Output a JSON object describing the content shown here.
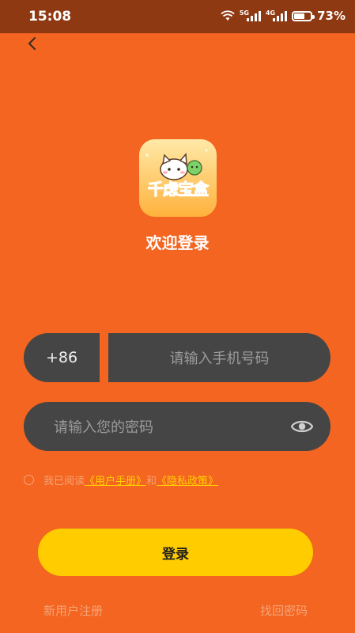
{
  "status_bar": {
    "time": "15:08",
    "signal_5g": "5G",
    "signal_4g": "4G",
    "battery_percent": "73%",
    "battery_level": 0.73
  },
  "header": {
    "back_icon": "chevron-left-icon"
  },
  "logo": {
    "text": "千虑宝盒"
  },
  "welcome": {
    "title": "欢迎登录"
  },
  "phone": {
    "country_code": "+86",
    "placeholder": "请输入手机号码"
  },
  "password": {
    "placeholder": "请输入您的密码",
    "toggle_icon": "eye-icon"
  },
  "agreement": {
    "prefix": "我已阅读",
    "user_manual": "《用户手册》",
    "conjunction": "和",
    "privacy_policy": "《隐私政策》",
    "checked": false
  },
  "actions": {
    "login_label": "登录",
    "register_label": "新用户注册",
    "forgot_label": "找回密码"
  },
  "colors": {
    "background": "#f36520",
    "status_bar": "#8f3912",
    "input_bg": "#454545",
    "button": "#ffcc00",
    "link": "#ffd200"
  }
}
